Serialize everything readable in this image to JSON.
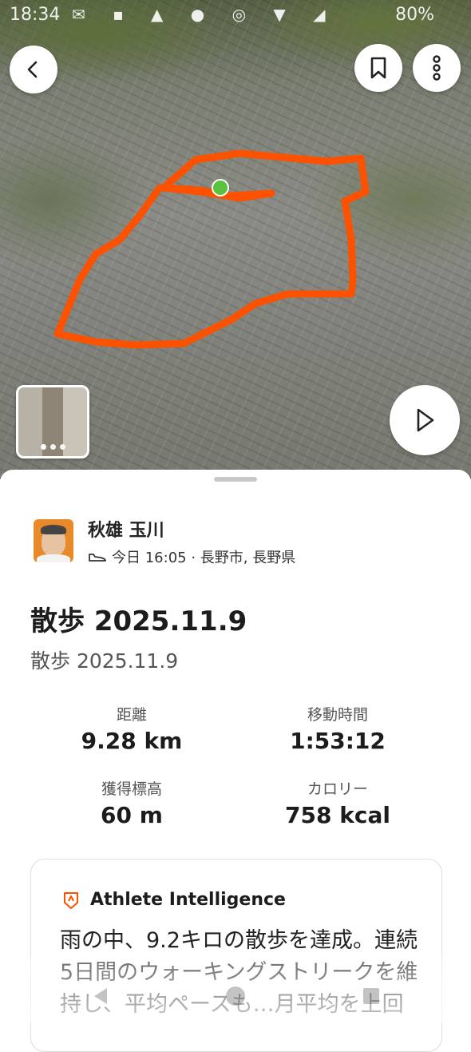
{
  "status_bar": {
    "time": "18:34",
    "battery": "80%"
  },
  "map": {
    "back_icon": "chevron-left-icon",
    "bookmark_icon": "bookmark-icon",
    "more_icon": "more-vertical-icon",
    "play_icon": "play-icon",
    "route_color": "#fc5200",
    "start_marker_color": "#5ac23f"
  },
  "athlete": {
    "name": "秋雄 玉川",
    "meta": "今日 16:05 · 長野市, 長野県",
    "activity_icon": "shoe-icon"
  },
  "activity": {
    "title": "散歩 2025.11.9",
    "subtitle": "散歩 2025.11.9"
  },
  "stats": [
    {
      "label": "距離",
      "value": "9.28 km"
    },
    {
      "label": "移動時間",
      "value": "1:53:12"
    },
    {
      "label": "獲得標高",
      "value": "60 m"
    },
    {
      "label": "カロリー",
      "value": "758 kcal"
    }
  ],
  "ai_card": {
    "icon": "athlete-intelligence-icon",
    "title": "Athlete Intelligence",
    "text": "雨の中、9.2キロの散歩を達成。連続5日間のウォーキングストリークを維持し、平均ペースも…月平均を上回"
  },
  "colors": {
    "accent": "#fc5200"
  }
}
